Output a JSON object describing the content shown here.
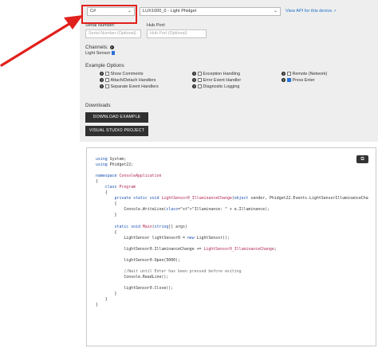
{
  "config": {
    "language_select": "C#",
    "device_select": "LUX1000_0 - Light Phidget",
    "view_api_link": "View API for this device",
    "serial_number_label": "Serial Number:",
    "serial_number_placeholder": "Serial Number (Optional)",
    "hub_port_label": "Hub Port:",
    "hub_port_placeholder": "Hub Port (Optional)",
    "channels_label": "Channels:",
    "channel_name": "Light Sensor",
    "example_options_label": "Example Options",
    "options": [
      {
        "label": "Show Comments",
        "checked": false
      },
      {
        "label": "Exception Handling",
        "checked": false
      },
      {
        "label": "Remote (Network)",
        "checked": false
      },
      {
        "label": "Attach/Detach Handlers",
        "checked": false
      },
      {
        "label": "Error Event Handler",
        "checked": false
      },
      {
        "label": "Press Enter",
        "checked": true
      },
      {
        "label": "Separate Event Handlers",
        "checked": false
      },
      {
        "label": "Diagnostic Logging",
        "checked": false
      }
    ],
    "downloads_label": "Downloads",
    "download_example_button": "DOWNLOAD EXAMPLE",
    "visual_studio_button": "VISUAL STUDIO PROJECT"
  },
  "code": {
    "copy_icon": "copy-icon",
    "lines": [
      "using System;",
      "using Phidget22;",
      "",
      "namespace ConsoleApplication",
      "{",
      "    class Program",
      "    {",
      "        private static void LightSensor0_IlluminanceChange(object sender, Phidget22.Events.LightSensorIlluminanceCha",
      "        {",
      "            Console.WriteLine(\"Illuminance: \" + e.Illuminance);",
      "        }",
      "",
      "        static void Main(string[] args)",
      "        {",
      "            LightSensor lightSensor0 = new LightSensor();",
      "",
      "            lightSensor0.IlluminanceChange += LightSensor0_IlluminanceChange;",
      "",
      "            lightSensor0.Open(5000);",
      "",
      "            //Wait until Enter has been pressed before exiting",
      "            Console.ReadLine();",
      "",
      "            lightSensor0.Close();",
      "        }",
      "    }",
      "}"
    ]
  },
  "colors": {
    "annotation_red": "#e0201c",
    "link_blue": "#1e6fc9",
    "panel_gray": "#eeeeee",
    "button_dark": "#303030"
  }
}
